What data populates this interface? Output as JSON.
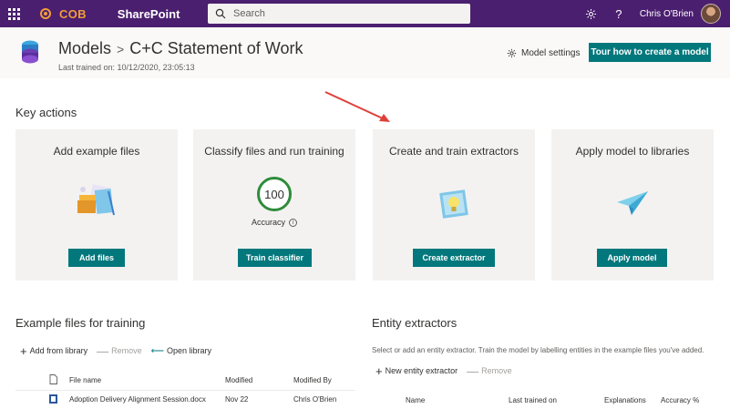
{
  "suite": {
    "org_name": "COB",
    "app_name": "SharePoint",
    "search_placeholder": "Search",
    "user_name": "Chris O'Brien",
    "help_glyph": "?",
    "colors": {
      "bar": "#4b1f6f",
      "accent": "#f29c38"
    }
  },
  "header": {
    "breadcrumb_root": "Models",
    "separator": ">",
    "model_name": "C+C Statement of Work",
    "last_trained": "Last trained on: 10/12/2020, 23:05:13",
    "settings_label": "Model settings",
    "tour_label": "Tour how to create a model"
  },
  "key_actions": {
    "title": "Key actions",
    "cards": [
      {
        "title": "Add example files",
        "button": "Add files",
        "icon": "files-illustration-icon"
      },
      {
        "title": "Classify files and run training",
        "button": "Train classifier",
        "score": "100",
        "score_label": "Accuracy",
        "icon": "accuracy-ring-icon"
      },
      {
        "title": "Create and train extractors",
        "button": "Create extractor",
        "icon": "lightbulb-illustration-icon"
      },
      {
        "title": "Apply model to libraries",
        "button": "Apply model",
        "icon": "paper-plane-icon"
      }
    ]
  },
  "example_files": {
    "title": "Example files for training",
    "toolbar": {
      "add": "Add from library",
      "remove": "Remove",
      "open": "Open library"
    },
    "columns": {
      "name": "File name",
      "modified": "Modified",
      "modified_by": "Modified By"
    },
    "rows": [
      {
        "name": "Adoption Delivery Alignment Session.docx",
        "modified": "Nov 22",
        "modified_by": "Chris O'Brien"
      }
    ]
  },
  "entity_extractors": {
    "title": "Entity extractors",
    "description": "Select or add an entity extractor. Train the model by labelling entities in the example files you've added.",
    "toolbar": {
      "add": "New entity extractor",
      "remove": "Remove"
    },
    "columns": {
      "name": "Name",
      "last_trained": "Last trained on",
      "explanations": "Explanations",
      "accuracy": "Accuracy %"
    }
  },
  "colors": {
    "primary_button": "#03787c",
    "annotation_arrow": "#e0403a",
    "success_ring": "#2e8b3a"
  }
}
